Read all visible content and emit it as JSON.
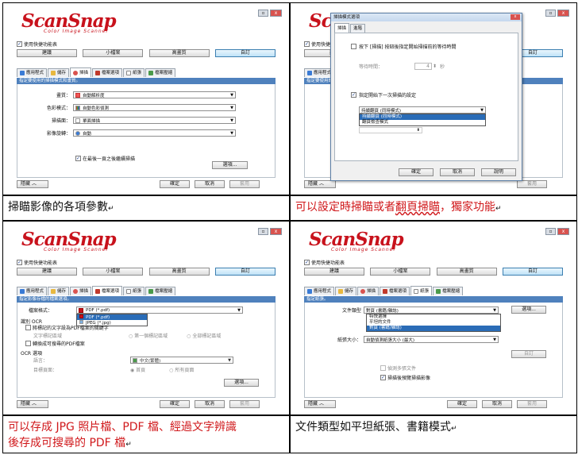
{
  "window": {
    "min": "▫",
    "close": "x"
  },
  "logo": {
    "main": "ScanSnap",
    "sub": "Color Image Scanner"
  },
  "quick_menu": "使用快捷功能表",
  "profiles": [
    "建議",
    "小檔案",
    "高畫質",
    "自訂"
  ],
  "tabs": [
    "應用程式",
    "儲存",
    "掃描",
    "檔案選項",
    "紙張",
    "檔案壓縮"
  ],
  "bottom": {
    "detail": "隱藏",
    "ok": "確定",
    "cancel": "取消",
    "apply": "套用"
  },
  "panel1": {
    "header": "指定要使用的掃描模式和畫質。",
    "rows": [
      {
        "label": "畫質：",
        "value": "自動解析度"
      },
      {
        "label": "色彩模式：",
        "value": "自動色彩偵測"
      },
      {
        "label": "掃描面：",
        "value": "單面掃描"
      },
      {
        "label": "影像旋轉：",
        "value": "自動"
      }
    ],
    "continue": "在最後一頁之後繼續掃描",
    "option_btn": "選項..."
  },
  "caption1": "掃瞄影像的各項參數",
  "panel2": {
    "dialog_title": "掃描模式選項",
    "tabs": [
      "掃描",
      "進階"
    ],
    "wait_check": "按下 [掃描] 按鈕後指定開始掃描前的等待時間",
    "wait_label": "等待時間：",
    "wait_value": "4",
    "wait_unit": "秒",
    "next_check": "指定開始下一次掃描的設定",
    "combo": "持續翻頁 (同時模式)",
    "options": [
      "持續翻頁 (同時模式)",
      "翻頁檢查模式"
    ],
    "ok": "確定",
    "cancel": "取消",
    "help": "說明"
  },
  "caption2": {
    "a": "可以設定時掃瞄或者",
    "b": "翻頁掃瞄",
    "c": "，獨家功能"
  },
  "panel3": {
    "header": "指定影像存檔的檔案選項。",
    "format_label": "檔案格式：",
    "format_value": "PDF (*.pdf)",
    "format_options": [
      "PDF (*.pdf)",
      "JPEG (*.jpg)"
    ],
    "ocr_title": "識別 OCR",
    "ocr_check1": "將標記的文字設為PDF檔案的關鍵字",
    "ocr_sub_label": "文字標記區域",
    "ocr_radio1": "第一個標記區域",
    "ocr_radio2": "全部標記區域",
    "ocr_check2": "轉換成可搜尋的PDF檔案",
    "ocr_opts": "OCR 選項",
    "lang_label": "語言：",
    "lang_value": "中文(繁體)",
    "page_label": "目標頁面：",
    "page_r1": "首頁",
    "page_r2": "所有頁面",
    "option_btn": "選項..."
  },
  "caption3": {
    "line1": "可以存成 JPG 照片檔、PDF 檔、經過文字辨識",
    "line2": "後存成可搜尋的 PDF 檔"
  },
  "panel4": {
    "header": "指定紙張。",
    "doc_label": "文件類型",
    "doc_value": "對頁 (書籍/雜誌)",
    "doc_options": [
      "特快選擇",
      "平坦的文件",
      "對頁 (書籍/雜誌)"
    ],
    "size_label": "紙張大小：",
    "size_value": "自動偵測紙張大小 (最大)",
    "custom_btn": "自訂",
    "multi_feed": "偵測多張文件",
    "preview": "掃描後預覽掃描影像",
    "option_btn": "選項..."
  },
  "caption4": "文件類型如平坦紙張、書籍模式"
}
